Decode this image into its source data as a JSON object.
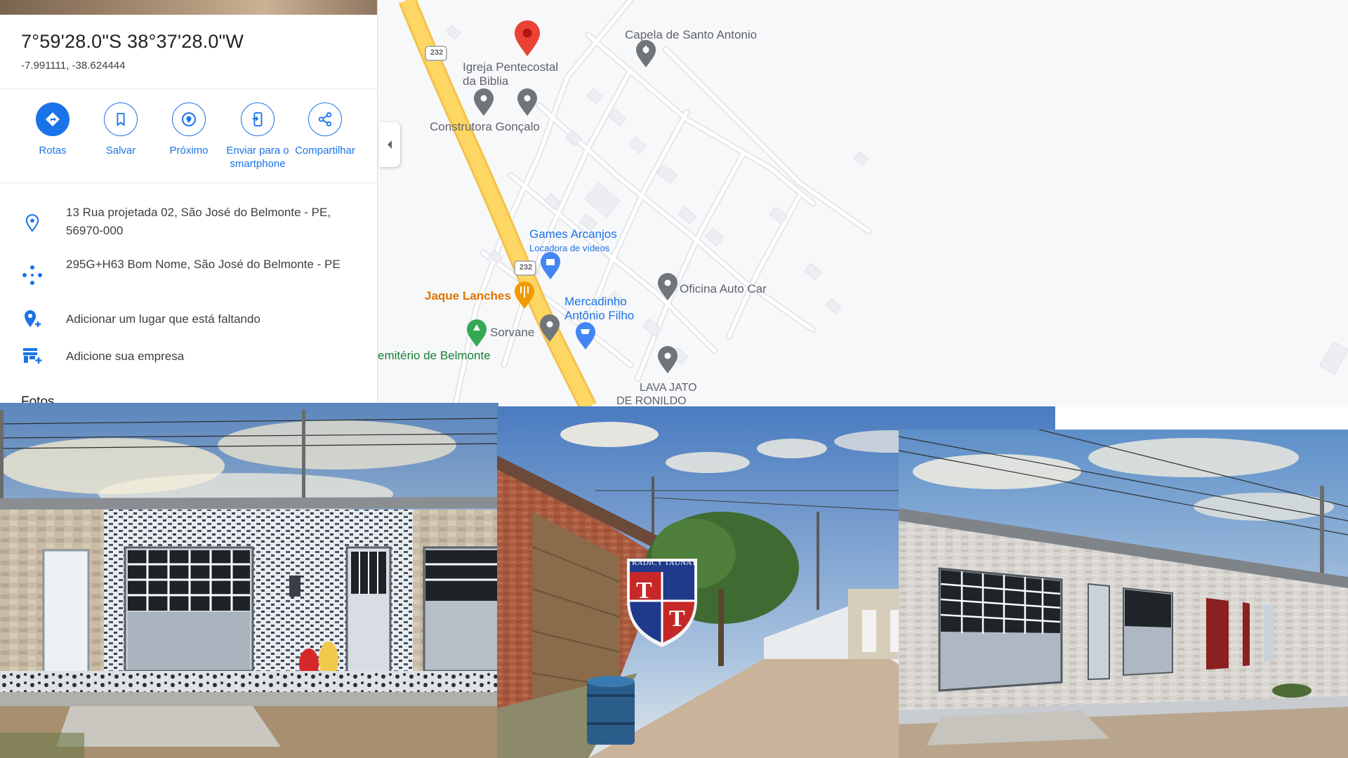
{
  "place": {
    "coordinates_dms": "7°59'28.0\"S 38°37'28.0\"W",
    "coordinates_decimal": "-7.991111, -38.624444"
  },
  "actions": [
    {
      "label": "Rotas",
      "icon": "directions-icon"
    },
    {
      "label": "Salvar",
      "icon": "bookmark-icon"
    },
    {
      "label": "Próximo",
      "icon": "nearby-icon"
    },
    {
      "label": "Enviar para o smartphone",
      "icon": "send-to-phone-icon"
    },
    {
      "label": "Compartilhar",
      "icon": "share-icon"
    }
  ],
  "info": {
    "address": "13 Rua projetada 02, São José do Belmonte - PE, 56970-000",
    "plus_code": "295G+H63 Bom Nome, São José do Belmonte - PE",
    "add_missing_place": "Adicionar um lugar que está faltando",
    "add_business": "Adicione sua empresa"
  },
  "photos_heading": "Fotos",
  "map": {
    "route_shield_top": "232",
    "route_shield_mid": "232",
    "labels": {
      "chapel": "Capela de Santo Antonio",
      "church_line1": "Igreja Pentecostal",
      "church_line2": "da Biblia",
      "construction": "Construtora Gonçalo",
      "games": "Games Arcanjos",
      "games_sub": "Locadora de vídeos",
      "oficina": "Oficina Auto Car",
      "jaque": "Jaque Lanches",
      "mercadinho_line1": "Mercadinho",
      "mercadinho_line2": "Antônio Filho",
      "sorvane": "Sorvane",
      "cemiterio": "emitério de Belmonte",
      "lava_line1": "LAVA JATO",
      "lava_line2": "DE RONILDO"
    }
  },
  "watermark": {
    "name": "TRADICY TAUNAY",
    "letter": "T"
  },
  "colors": {
    "accent": "#1a73e8",
    "pin_red": "#ea4335",
    "road_yellow": "#fdd663",
    "food_orange": "#e37400",
    "park_green": "#188038"
  }
}
